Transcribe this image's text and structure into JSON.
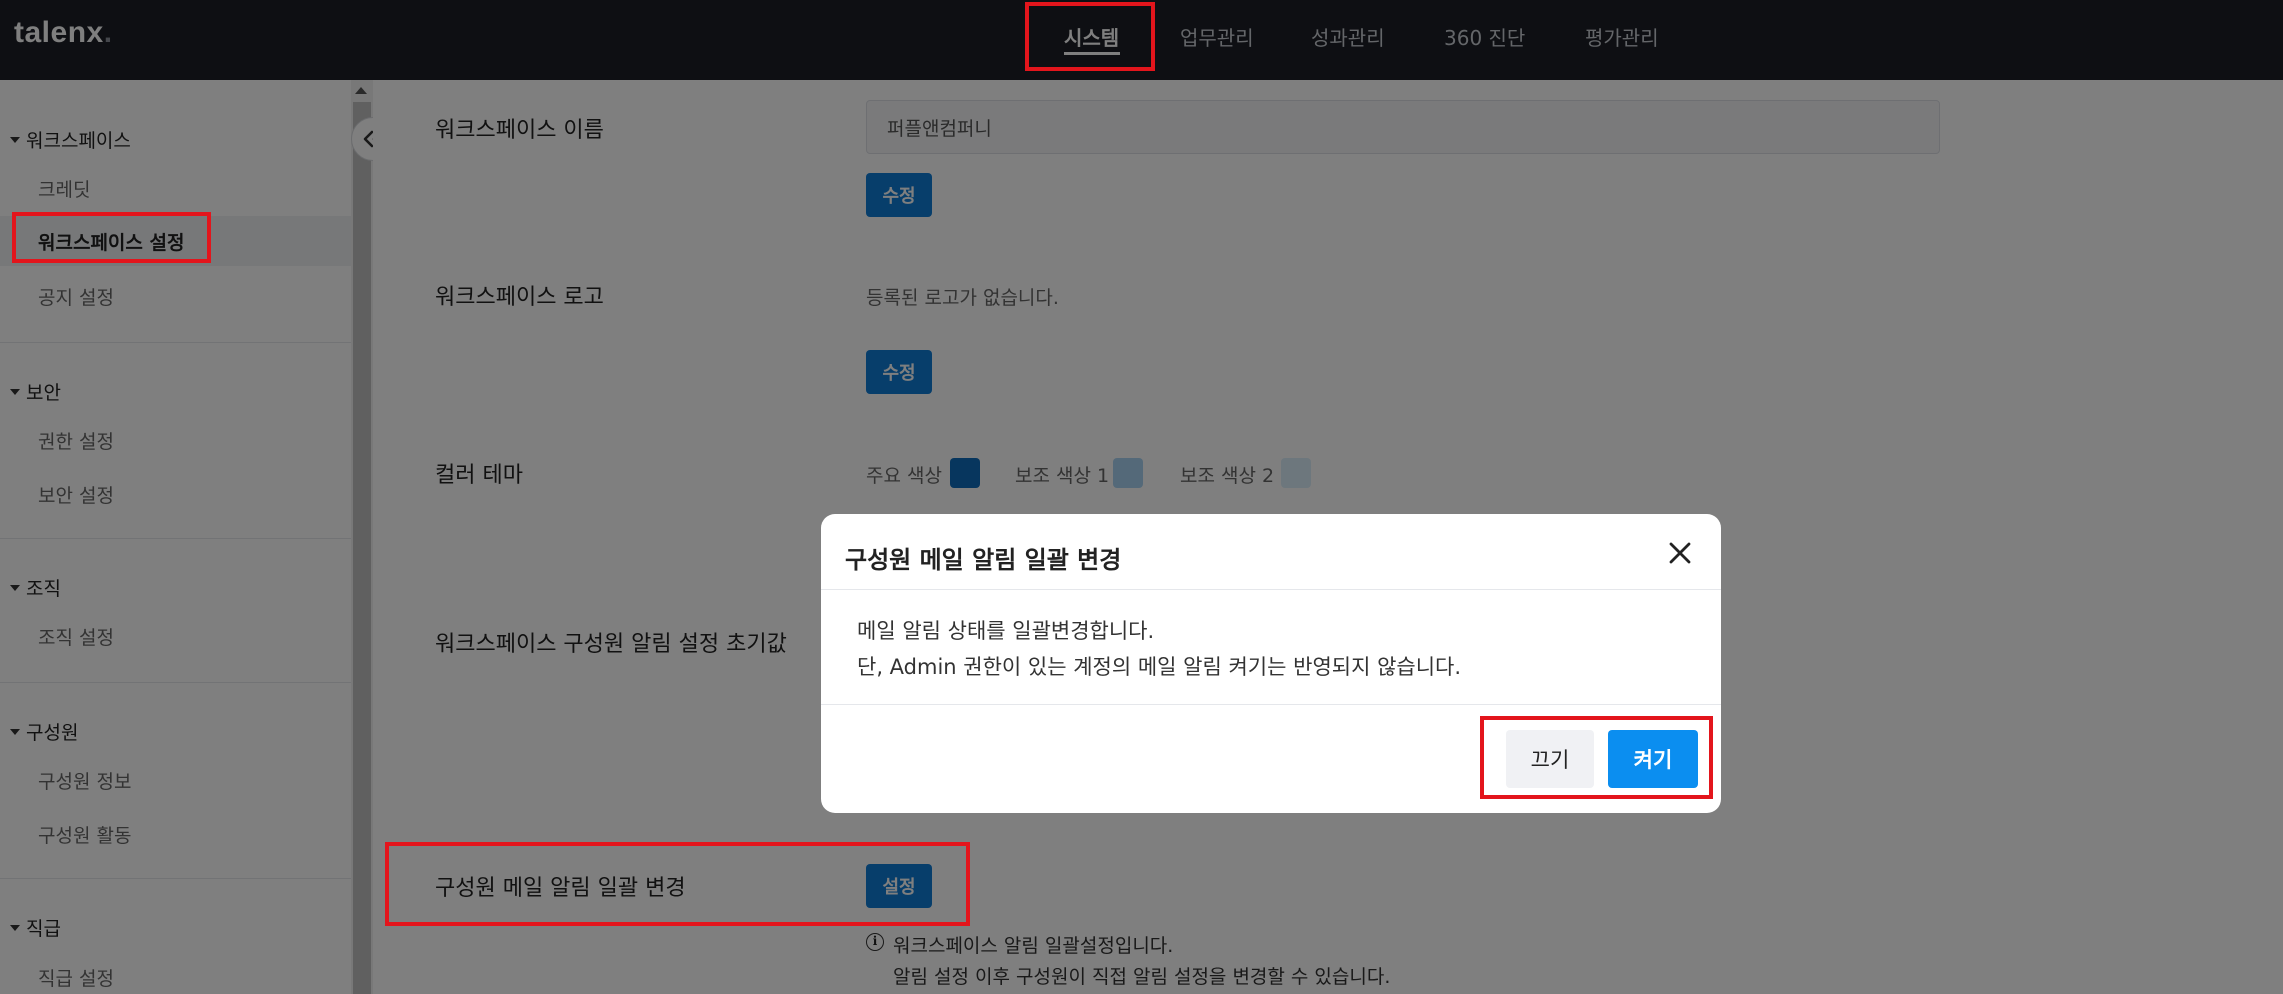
{
  "app": {
    "logo_text": "talenx",
    "logo_dot": ".",
    "nav": [
      {
        "label": "시스템",
        "active": true
      },
      {
        "label": "업무관리",
        "active": false
      },
      {
        "label": "성과관리",
        "active": false
      },
      {
        "label": "360 진단",
        "active": false
      },
      {
        "label": "평가관리",
        "active": false
      }
    ]
  },
  "sidebar": {
    "groups": [
      {
        "label": "워크스페이스",
        "items": [
          "크레딧",
          "워크스페이스 설정",
          "공지 설정"
        ]
      },
      {
        "label": "보안",
        "items": [
          "권한 설정",
          "보안 설정"
        ]
      },
      {
        "label": "조직",
        "items": [
          "조직 설정"
        ]
      },
      {
        "label": "구성원",
        "items": [
          "구성원 정보",
          "구성원 활동"
        ]
      },
      {
        "label": "직급",
        "items": [
          "직급 설정"
        ]
      }
    ],
    "active_item": "워크스페이스 설정",
    "collapse_icon": "double-chevron-left-icon"
  },
  "main": {
    "workspace_name": {
      "label": "워크스페이스 이름",
      "value": "퍼플앤컴퍼니",
      "edit_label": "수정"
    },
    "workspace_logo": {
      "label": "워크스페이스 로고",
      "empty_text": "등록된 로고가 없습니다.",
      "edit_label": "수정"
    },
    "color_theme": {
      "label": "컬러 테마",
      "primary_label": "주요 색상",
      "secondary1_label": "보조 색상 1",
      "secondary2_label": "보조 색상 2",
      "primary_color": "#0f6cbd",
      "secondary1_color": "#a9d3f2",
      "secondary2_color": "#dbeefb"
    },
    "member_alert_default": {
      "label": "워크스페이스 구성원 알림 설정 초기값"
    },
    "member_mail_bulk": {
      "label": "구성원 메일 알림 일괄 변경",
      "button_label": "설정",
      "info_line1": "워크스페이스 알림 일괄설정입니다.",
      "info_line2": "알림 설정 이후 구성원이 직접 알림 설정을 변경할 수 있습니다."
    }
  },
  "modal": {
    "title": "구성원 메일 알림 일괄 변경",
    "body_line1": "메일 알림 상태를 일괄변경합니다.",
    "body_line2": "단, Admin 권한이 있는 계정의 메일 알림 켜기는 반영되지 않습니다.",
    "off_label": "끄기",
    "on_label": "켜기"
  },
  "colors": {
    "topbar": "#1c1f26",
    "accent_blue": "#0f7cd6",
    "modal_primary": "#0b8ef0",
    "highlight": "#e3151c"
  }
}
